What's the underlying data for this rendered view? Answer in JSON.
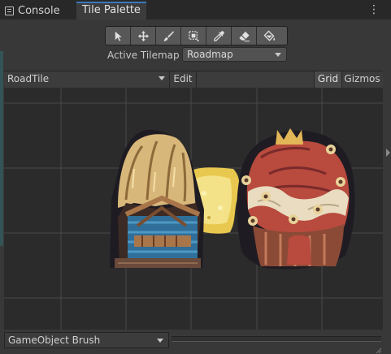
{
  "tabs": {
    "console": "Console",
    "tile_palette": "Tile Palette",
    "menu_glyph": "⋮"
  },
  "toolbar": {
    "tools": [
      {
        "name": "select-tool",
        "icon": "arrow-icon"
      },
      {
        "name": "move-tool",
        "icon": "move-arrows-icon"
      },
      {
        "name": "paint-tool",
        "icon": "brush-icon"
      },
      {
        "name": "box-fill-tool",
        "icon": "box-fill-icon"
      },
      {
        "name": "picker-tool",
        "icon": "eyedropper-icon"
      },
      {
        "name": "erase-tool",
        "icon": "eraser-icon"
      },
      {
        "name": "flood-fill-tool",
        "icon": "paint-bucket-icon"
      }
    ],
    "active_tilemap_label": "Active Tilemap",
    "active_tilemap_value": "Roadmap"
  },
  "palette_bar": {
    "palette_name": "RoadTile",
    "edit_label": "Edit",
    "grid_label": "Grid",
    "gizmos_label": "Gizmos"
  },
  "canvas": {
    "tiles": [
      "thatched-hut-tile",
      "path-tile",
      "red-hut-tile"
    ],
    "grid_visible": true
  },
  "brush": {
    "value": "GameObject Brush"
  },
  "colors": {
    "accent": "#3a79bb",
    "background": "#383838",
    "canvas": "#2b2b2b"
  }
}
